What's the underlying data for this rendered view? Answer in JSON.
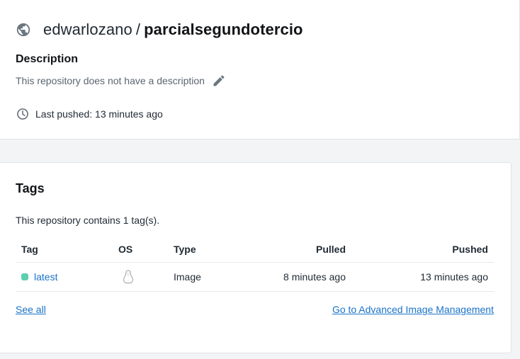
{
  "repo": {
    "owner": "edwarlozano",
    "separator": "/",
    "name": "parcialsegundotercio",
    "description_label": "Description",
    "description_text": "This repository does not have a description",
    "last_pushed": "Last pushed: 13 minutes ago"
  },
  "tags": {
    "title": "Tags",
    "count_text": "This repository contains 1 tag(s).",
    "columns": [
      "Tag",
      "OS",
      "Type",
      "Pulled",
      "Pushed"
    ],
    "rows": [
      {
        "tag": "latest",
        "os": "linux-icon",
        "type": "Image",
        "pulled": "8 minutes ago",
        "pushed": "13 minutes ago",
        "status_color": "#5ccfb0"
      }
    ],
    "see_all": "See all",
    "advanced_link": "Go to Advanced Image Management"
  },
  "colors": {
    "link": "#1a73c8",
    "tag_status": "#5ccfb0",
    "icon": "#6b7680"
  },
  "icons": {
    "title": "globe-icon",
    "edit": "pencil-icon",
    "pushed": "clock-icon"
  }
}
